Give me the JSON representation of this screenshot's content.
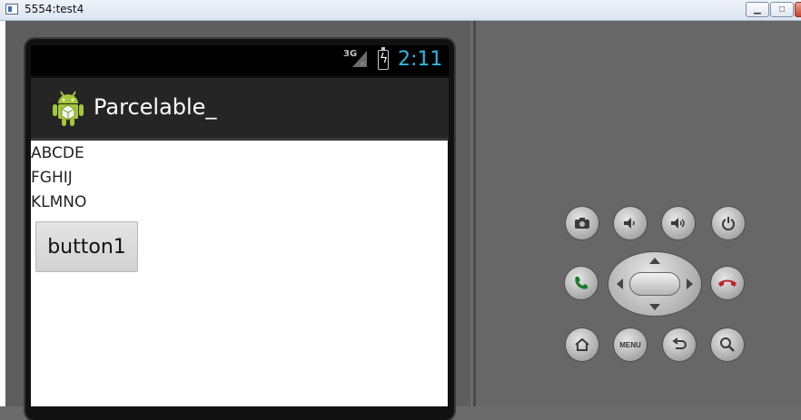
{
  "window": {
    "title": "5554:test4",
    "minimize_glyph": "▁",
    "maximize_glyph": "□",
    "close_glyph": "✕"
  },
  "status_bar": {
    "network": "3G",
    "time": "2:11",
    "colors": {
      "clock": "#33b5e5"
    }
  },
  "action_bar": {
    "app_title": "Parcelable_",
    "icon": "android-robot-icon"
  },
  "content": {
    "lines": [
      "ABCDE",
      "FGHIJ",
      "KLMNO"
    ],
    "button_label": "button1"
  },
  "hardware_keys": {
    "menu_label": "MENU",
    "icons": [
      "camera-icon",
      "volume-down-icon",
      "volume-up-icon",
      "power-icon",
      "call-icon",
      "dpad",
      "end-call-icon",
      "home-icon",
      "menu-icon",
      "back-icon",
      "search-icon"
    ],
    "colors": {
      "call": "#1a7a2a",
      "end_call": "#c0202a"
    }
  }
}
